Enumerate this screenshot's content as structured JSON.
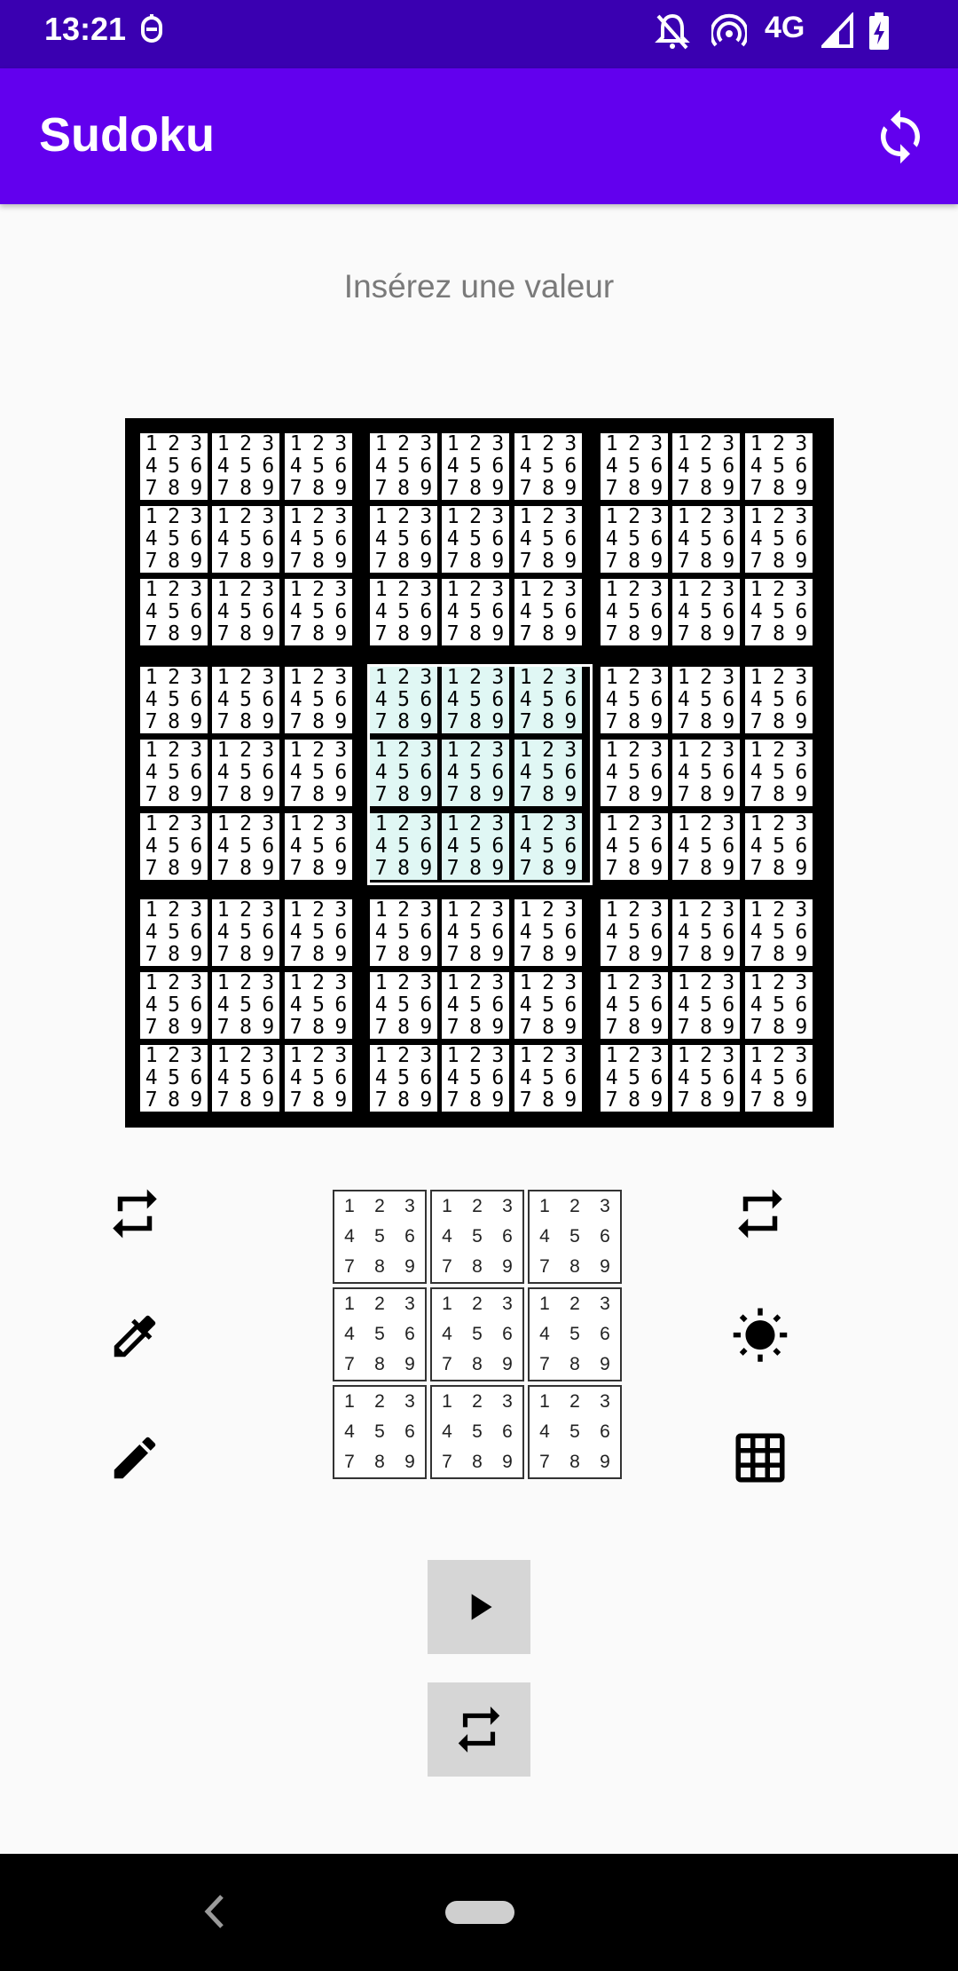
{
  "status_bar": {
    "time": "13:21",
    "network": "4G",
    "icons": [
      "usb-debug-icon",
      "notifications-off-icon",
      "hotspot-icon",
      "signal-icon",
      "battery-charging-icon"
    ]
  },
  "app_bar": {
    "title": "Sudoku",
    "action_icon": "refresh-icon"
  },
  "prompt": "Insérez une valeur",
  "board": {
    "candidate_digits": [
      "1",
      "2",
      "3",
      "4",
      "5",
      "6",
      "7",
      "8",
      "9"
    ],
    "highlighted_box": "center",
    "highlight_color": "#e0f7f4"
  },
  "number_picker": {
    "digits": [
      "1",
      "2",
      "3",
      "4",
      "5",
      "6",
      "7",
      "8",
      "9"
    ]
  },
  "left_tools": [
    "repeat-icon",
    "eyedropper-icon",
    "pencil-icon"
  ],
  "right_tools": [
    "repeat-icon",
    "brightness-icon",
    "grid-icon"
  ],
  "bottom_buttons": [
    "play-icon",
    "repeat-icon"
  ],
  "colors": {
    "status_bar": "#3a00b1",
    "app_bar": "#6200ee",
    "background": "#fafafa",
    "prompt_text": "#7a7a7a",
    "button_gray": "#d6d6d6"
  }
}
